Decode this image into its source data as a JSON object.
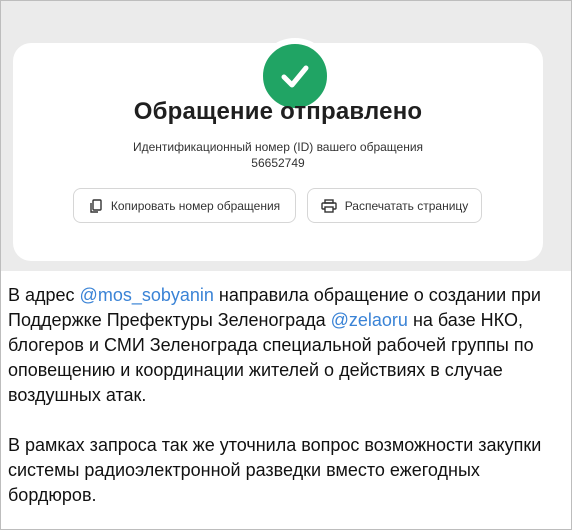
{
  "card": {
    "title": "Обращение отправлено",
    "id_label": "Идентификационный номер (ID) вашего обращения",
    "id_value": "56652749",
    "buttons": {
      "copy_label": "Копировать номер обращения",
      "print_label": "Распечатать страницу"
    }
  },
  "post": {
    "p1_before": "В адрес ",
    "mention1": "@mos_sobyanin",
    "p1_middle": " направила обращение о создании при Поддержке Префектуры Зеленограда  ",
    "mention2": "@zelaoru",
    "p1_after": " на базе НКО, блогеров и СМИ Зеленограда специальной рабочей группы по оповещению и координации  жителей о действиях в случае воздушных атак.",
    "p2": "В рамках запроса так же уточнила вопрос возможности закупки системы радиоэлектронной разведки вместо ежегодных бордюров."
  },
  "colors": {
    "success_green": "#20a464",
    "mention_blue": "#3a83d6",
    "screenshot_background": "#ebebeb"
  },
  "icons": {
    "success": "check-icon",
    "copy": "copy-icon",
    "print": "printer-icon"
  }
}
